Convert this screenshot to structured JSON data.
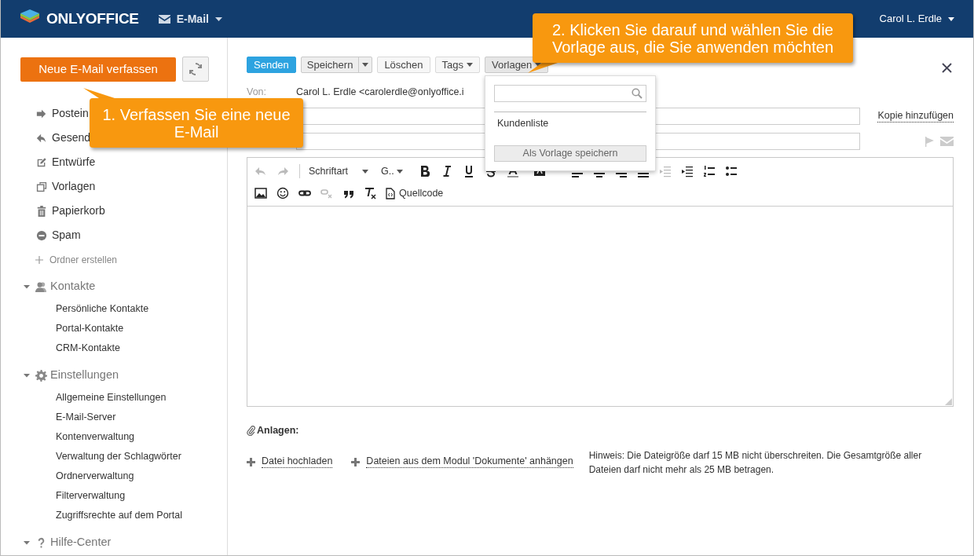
{
  "header": {
    "logo": "ONLYOFFICE",
    "module": "E-Mail",
    "user": "Carol L. Erdle"
  },
  "sidebar": {
    "compose_button": "Neue E-Mail verfassen",
    "folders": [
      {
        "label": "Postein"
      },
      {
        "label": "Gesend"
      },
      {
        "label": "Entwürfe"
      },
      {
        "label": "Vorlagen"
      },
      {
        "label": "Papierkorb"
      },
      {
        "label": "Spam"
      }
    ],
    "create_folder": "Ordner erstellen",
    "groups": [
      {
        "title": "Kontakte",
        "expanded": true,
        "items": [
          "Persönliche Kontakte",
          "Portal-Kontakte",
          "CRM-Kontakte"
        ]
      },
      {
        "title": "Einstellungen",
        "expanded": true,
        "items": [
          "Allgemeine Einstellungen",
          "E-Mail-Server",
          "Kontenverwaltung",
          "Verwaltung der Schlagwörter",
          "Ordnerverwaltung",
          "Filterverwaltung",
          "Zugriffsrechte auf dem Portal"
        ]
      },
      {
        "title": "Hilfe-Center",
        "expanded": true
      }
    ]
  },
  "toolbar": [
    {
      "label": "Senden",
      "kind": "primary",
      "open": false
    },
    {
      "label": "Speichern",
      "kind": "split",
      "open": false
    },
    {
      "label": "Löschen",
      "kind": "plain",
      "open": false
    },
    {
      "label": "Tags",
      "kind": "dropdown",
      "open": false
    },
    {
      "label": "Vorlagen",
      "kind": "dropdown",
      "open": true
    }
  ],
  "templates_menu": {
    "items": [
      "Kundenliste"
    ],
    "save_button": "Als Vorlage speichern"
  },
  "compose": {
    "from_label": "Von:",
    "from_value": "Carol L. Erdle <carolerdle@onlyoffice.i",
    "add_copy": "Kopie hinzufügen"
  },
  "editor": {
    "font_family": "Schriftart",
    "font_size": "G..",
    "source_button": "Quellcode"
  },
  "attachments": {
    "label": "Anlagen:",
    "links": [
      "Datei hochladen",
      "Dateien aus dem Modul 'Dokumente' anhängen"
    ],
    "hint": "Hinweis: Die Dateigröße darf 15 MB nicht überschreiten. Die Gesamtgröße aller Dateien darf nicht mehr als 25 MB betragen."
  },
  "callouts": [
    {
      "text": "1. Verfassen Sie eine neue E-Mail"
    },
    {
      "text": "2. Klicken Sie darauf und wählen Sie die Vorlage aus, die Sie anwenden möchten"
    }
  ]
}
